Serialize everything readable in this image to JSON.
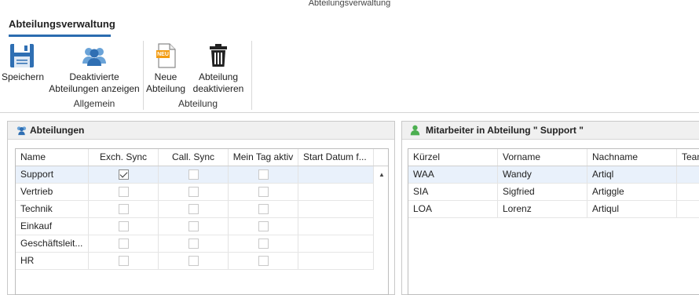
{
  "window": {
    "title": "Abteilungsverwaltung"
  },
  "ribbon": {
    "tab": "Abteilungsverwaltung",
    "groups": {
      "allgemein": "Allgemein",
      "abteilung": "Abteilung"
    },
    "buttons": {
      "save": "Speichern",
      "show_inactive": "Deaktivierte\nAbteilungen anzeigen",
      "new": "Neue\nAbteilung",
      "new_badge": "NEU",
      "deactivate": "Abteilung\ndeaktivieren"
    }
  },
  "departments": {
    "title": "Abteilungen",
    "columns": [
      "Name",
      "Exch. Sync",
      "Call. Sync",
      "Mein Tag aktiv",
      "Start Datum f..."
    ],
    "rows": [
      {
        "name": "Support",
        "exch": true,
        "call": false,
        "tag": false,
        "selected": true
      },
      {
        "name": "Vertrieb",
        "exch": false,
        "call": false,
        "tag": false
      },
      {
        "name": "Technik",
        "exch": false,
        "call": false,
        "tag": false
      },
      {
        "name": "Einkauf",
        "exch": false,
        "call": false,
        "tag": false
      },
      {
        "name": "Geschäftsleit...",
        "exch": false,
        "call": false,
        "tag": false
      },
      {
        "name": "HR",
        "exch": false,
        "call": false,
        "tag": false
      }
    ]
  },
  "employees": {
    "title": "Mitarbeiter in Abteilung \" Support \"",
    "columns": [
      "Kürzel",
      "Vorname",
      "Nachname",
      "Tean"
    ],
    "rows": [
      {
        "kuerzel": "WAA",
        "vorname": "Wandy",
        "nachname": "Artiql",
        "selected": true
      },
      {
        "kuerzel": "SIA",
        "vorname": "Sigfried",
        "nachname": "Artiggle"
      },
      {
        "kuerzel": "LOA",
        "vorname": "Lorenz",
        "nachname": "Artiqul"
      }
    ]
  },
  "colors": {
    "accent": "#2b6cb0",
    "selection": "#e9f1fb"
  }
}
